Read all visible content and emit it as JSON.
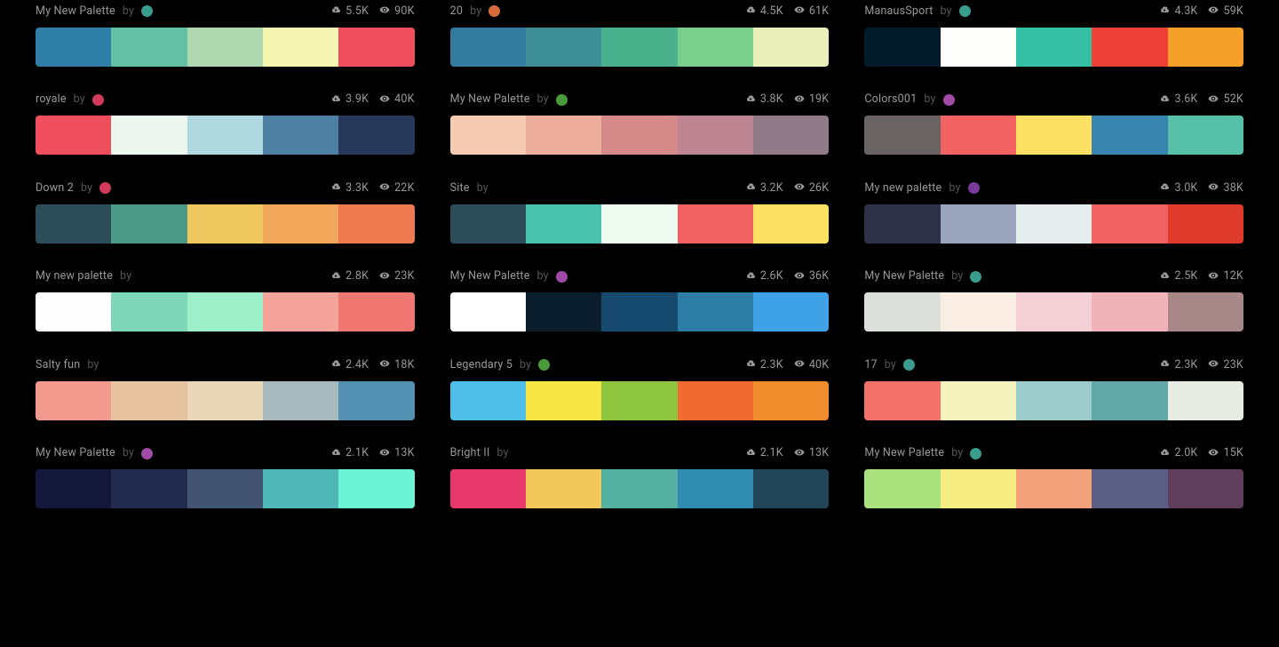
{
  "by_label": "by",
  "palettes": [
    {
      "title": "My New Palette",
      "by": "by",
      "avatar": "#3a9c8c",
      "downloads": "5.5K",
      "views": "90K",
      "colors": [
        "#2F7FA8",
        "#63C0A3",
        "#B0D8B0",
        "#F3F5B0",
        "#EF4F5D"
      ]
    },
    {
      "title": "20",
      "by": "by",
      "avatar": "#d96b3a",
      "downloads": "4.5K",
      "views": "61K",
      "colors": [
        "#337B9E",
        "#3D8D96",
        "#49B18B",
        "#7BCF8C",
        "#EBF0BB"
      ]
    },
    {
      "title": "ManausSport",
      "by": "by",
      "avatar": "#3a9c8c",
      "downloads": "4.3K",
      "views": "59K",
      "colors": [
        "#031A2A",
        "#FEFEFD",
        "#35BFA3",
        "#ED4137",
        "#F6A02C"
      ]
    },
    {
      "title": "royale",
      "by": "by",
      "avatar": "#d23a5b",
      "downloads": "3.9K",
      "views": "40K",
      "colors": [
        "#EF4F5D",
        "#EEF7EF",
        "#AFD9DE",
        "#4E80A3",
        "#273759"
      ]
    },
    {
      "title": "My New Palette",
      "by": "by",
      "avatar": "#4a9a3a",
      "downloads": "3.8K",
      "views": "19K",
      "colors": [
        "#F5CCB1",
        "#ECAE9A",
        "#D58A89",
        "#BD8591",
        "#8F7A87"
      ]
    },
    {
      "title": "Colors001",
      "by": "by",
      "avatar": "#a04aa8",
      "downloads": "3.6K",
      "views": "52K",
      "colors": [
        "#696463",
        "#F26262",
        "#FBE063",
        "#3A85AF",
        "#56C1A8"
      ]
    },
    {
      "title": "Down 2",
      "by": "by",
      "avatar": "#d23a5b",
      "downloads": "3.3K",
      "views": "22K",
      "colors": [
        "#2C4D58",
        "#4A9A85",
        "#EEC75F",
        "#F0A75A",
        "#F07A4F"
      ]
    },
    {
      "title": "Site",
      "by": "by",
      "avatar": null,
      "downloads": "3.2K",
      "views": "26K",
      "colors": [
        "#2C4D58",
        "#49C2AE",
        "#F0FBF1",
        "#F26262",
        "#FBE063"
      ]
    },
    {
      "title": "My new palette",
      "by": "by",
      "avatar": "#7a3a9c",
      "downloads": "3.0K",
      "views": "38K",
      "colors": [
        "#2E3148",
        "#9AA3BC",
        "#E4ECEE",
        "#F26262",
        "#DE3B2D"
      ]
    },
    {
      "title": "My new palette",
      "by": "by",
      "avatar": null,
      "downloads": "2.8K",
      "views": "23K",
      "colors": [
        "#FEFEFE",
        "#7ED7B8",
        "#9CEFC8",
        "#F4A49B",
        "#F07671"
      ]
    },
    {
      "title": "My New Palette",
      "by": "by",
      "avatar": "#a04aa8",
      "downloads": "2.6K",
      "views": "36K",
      "colors": [
        "#FFFFFF",
        "#0A1D2C",
        "#154A6E",
        "#2C7CA6",
        "#3FA1E6"
      ]
    },
    {
      "title": "My New Palette",
      "by": "by",
      "avatar": "#3a9c8c",
      "downloads": "2.5K",
      "views": "12K",
      "colors": [
        "#DCE0DA",
        "#FAEDE4",
        "#F4CFD5",
        "#F0B3BA",
        "#A88789"
      ]
    },
    {
      "title": "Salty fun",
      "by": "by",
      "avatar": null,
      "downloads": "2.4K",
      "views": "18K",
      "colors": [
        "#F39A8F",
        "#E7C2A1",
        "#E8D8B7",
        "#A8B9BE",
        "#5390B2"
      ]
    },
    {
      "title": "Legendary 5",
      "by": "by",
      "avatar": "#4a9a3a",
      "downloads": "2.3K",
      "views": "40K",
      "colors": [
        "#4FBFE9",
        "#F7E646",
        "#8EC63F",
        "#F16A31",
        "#F28D2E"
      ]
    },
    {
      "title": "17",
      "by": "by",
      "avatar": "#3a9c8c",
      "downloads": "2.3K",
      "views": "23K",
      "colors": [
        "#F4716A",
        "#F4F3BE",
        "#9CCBCB",
        "#60A7A5",
        "#E7ECE3"
      ]
    },
    {
      "title": "My New Palette",
      "by": "by",
      "avatar": "#a04aa8",
      "downloads": "2.1K",
      "views": "13K",
      "colors": [
        "#13173A",
        "#222B4F",
        "#425472",
        "#4FB7B6",
        "#6CF5D4"
      ]
    },
    {
      "title": "Bright II",
      "by": "by",
      "avatar": null,
      "downloads": "2.1K",
      "views": "13K",
      "colors": [
        "#E7376B",
        "#F3C85A",
        "#54B19F",
        "#2F8BAF",
        "#224458"
      ]
    },
    {
      "title": "My New Palette",
      "by": "by",
      "avatar": "#3a9c8c",
      "downloads": "2.0K",
      "views": "15K",
      "colors": [
        "#ABE27D",
        "#F6EE82",
        "#F2A17A",
        "#5B5F86",
        "#5F3E5C"
      ]
    }
  ]
}
